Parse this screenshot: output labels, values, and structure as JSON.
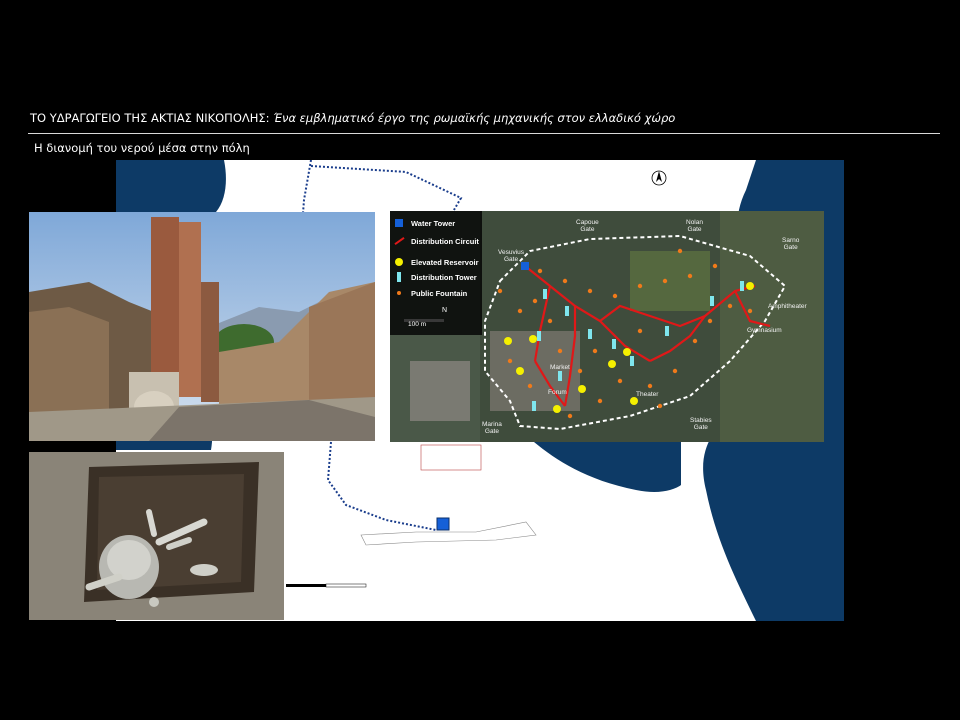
{
  "header": {
    "title_main": "ΤΟ ΥΔΡΑΓΩΓΕΙΟ ΤΗΣ ΑΚΤΙΑΣ ΝΙΚΟΠΟΛΗΣ:",
    "title_italic": "Ένα εμβληματικό έργο της ρωμαϊκής μηχανικής στον ελλαδικό χώρο",
    "subtitle": "Η διανομή του νερού μέσα στην πόλη"
  },
  "legend": {
    "water_tower": "Water Tower",
    "distribution_circuit": "Distribution Circuit",
    "elevated_reservoir": "Elevated Reservoir",
    "distribution_tower": "Distribution Tower",
    "public_fountain": "Public Fountain"
  },
  "scale": {
    "label": "100 m",
    "north": "N"
  },
  "gates": {
    "vesuvius": "Vesuvius\nGate",
    "capoue": "Capoue\nGate",
    "nolan": "Nolan\nGate",
    "sarno": "Sarno\nGate",
    "amphitheater": "Amphitheater",
    "gymnasium": "Gymnasium",
    "market": "Market",
    "forum": "Forum",
    "theater": "Theater",
    "marina": "Marina\nGate",
    "stabies": "Stabies\nGate"
  },
  "colors": {
    "sea": "#0d3a66",
    "circuit": "#e01818",
    "reservoir": "#f5f000",
    "tower": "#7fe6ee",
    "fountain": "#f07a1a",
    "water_tower": "#1560d8"
  }
}
